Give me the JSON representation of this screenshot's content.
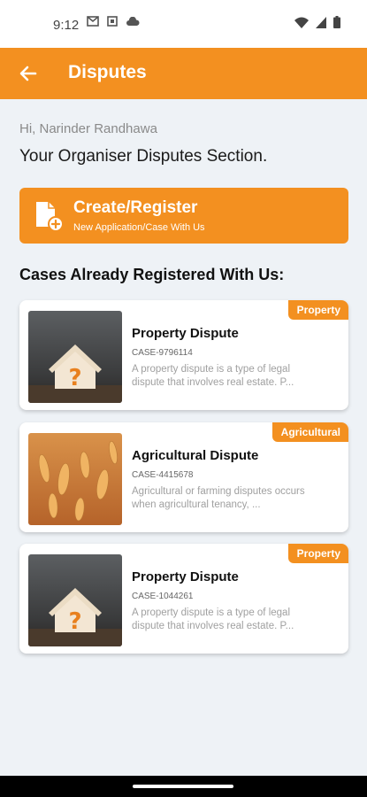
{
  "status_bar": {
    "time": "9:12",
    "icons": [
      "gmail-icon",
      "app-icon",
      "cloud-icon",
      "wifi-icon",
      "signal-icon",
      "battery-icon"
    ]
  },
  "app_bar": {
    "title": "Disputes",
    "back_icon": "arrow-left-icon"
  },
  "greeting": "Hi, Narinder Randhawa",
  "section_title": "Your Organiser Disputes Section.",
  "create_button": {
    "title": "Create/Register",
    "subtitle": "New Application/Case With Us",
    "icon": "document-add-icon"
  },
  "cases_heading": "Cases Already Registered With Us:",
  "cases": [
    {
      "badge": "Property",
      "title": "Property Dispute",
      "case_number": "CASE-9796114",
      "description": "A property dispute is a type of legal dispute that involves real estate. P...",
      "image": "house-question-image"
    },
    {
      "badge": "Agricultural",
      "title": "Agricultural Dispute",
      "case_number": "CASE-4415678",
      "description": "Agricultural or farming disputes occurs when agricultural tenancy, ...",
      "image": "wheat-field-image"
    },
    {
      "badge": "Property",
      "title": "Property Dispute",
      "case_number": "CASE-1044261",
      "description": "A property dispute is a type of legal dispute that involves real estate. P...",
      "image": "house-question-image"
    }
  ],
  "colors": {
    "accent": "#F39020",
    "background": "#EEF2F6"
  }
}
